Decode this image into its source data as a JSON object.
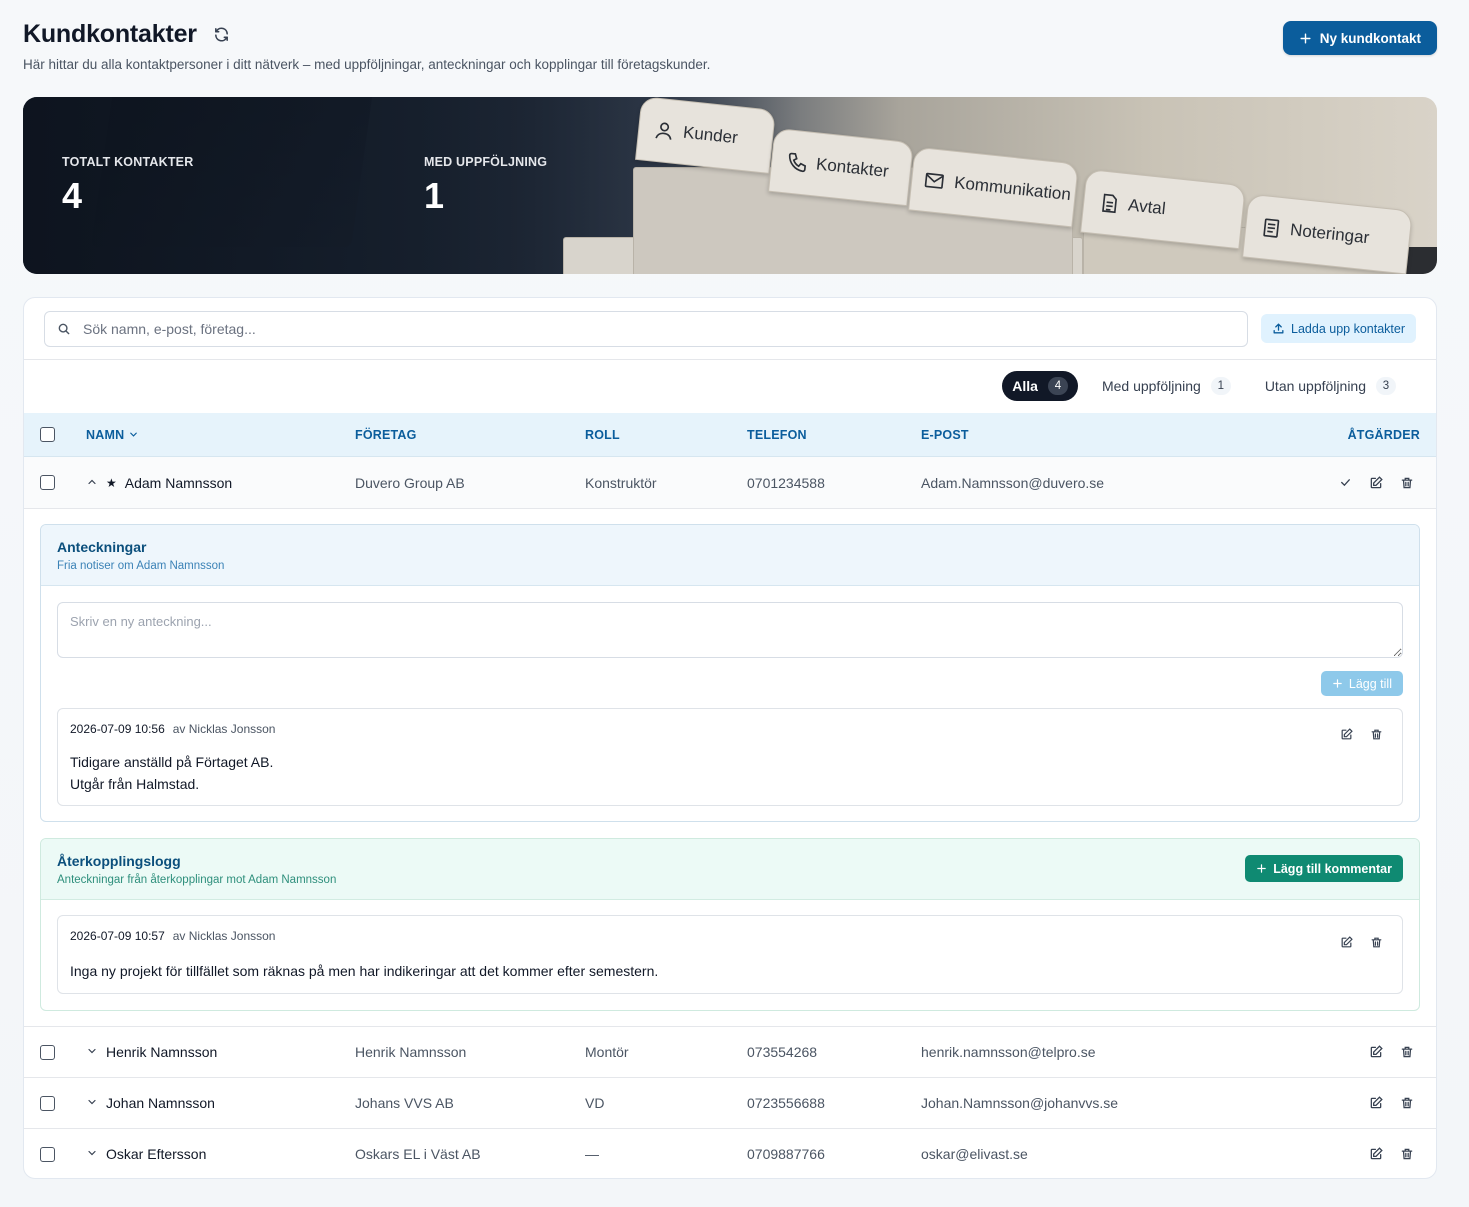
{
  "header": {
    "title": "Kundkontakter",
    "subtitle": "Här hittar du alla kontaktpersoner i ditt nätverk – med uppföljningar, anteckningar och kopplingar till företagskunder.",
    "new_button": "Ny kundkontakt"
  },
  "hero": {
    "stats": [
      {
        "label": "TOTALT KONTAKTER",
        "value": "4"
      },
      {
        "label": "MED UPPFÖLJNING",
        "value": "1"
      }
    ],
    "tabs": [
      "Kunder",
      "Kontakter",
      "Kommunikation",
      "Avtal",
      "Noteringar"
    ]
  },
  "search": {
    "placeholder": "Sök namn, e-post, företag..."
  },
  "upload_button": "Ladda upp kontakter",
  "filters": [
    {
      "label": "Alla",
      "count": "4"
    },
    {
      "label": "Med uppföljning",
      "count": "1"
    },
    {
      "label": "Utan uppföljning",
      "count": "3"
    }
  ],
  "table": {
    "columns": {
      "name": "NAMN",
      "company": "FÖRETAG",
      "role": "ROLL",
      "phone": "TELEFON",
      "email": "E-POST",
      "actions": "ÅTGÄRDER"
    },
    "rows": [
      {
        "name": "Adam Namnsson",
        "company": "Duvero Group AB",
        "role": "Konstruktör",
        "phone": "0701234588",
        "email": "Adam.Namnsson@duvero.se"
      },
      {
        "name": "Henrik Namnsson",
        "company": "Henrik Namnsson",
        "role": "Montör",
        "phone": "073554268",
        "email": "henrik.namnsson@telpro.se"
      },
      {
        "name": "Johan Namnsson",
        "company": "Johans VVS AB",
        "role": "VD",
        "phone": "0723556688",
        "email": "Johan.Namnsson@johanvvs.se"
      },
      {
        "name": "Oskar Eftersson",
        "company": "Oskars EL i Väst AB",
        "role": "—",
        "phone": "0709887766",
        "email": "oskar@elivast.se"
      }
    ]
  },
  "notes": {
    "title": "Anteckningar",
    "subtitle": "Fria notiser om Adam Namnsson",
    "placeholder": "Skriv en ny anteckning...",
    "add_button": "Lägg till",
    "entries": [
      {
        "timestamp": "2026-07-09 10:56",
        "author": "av Nicklas Jonsson",
        "line1": "Tidigare anställd på Förtaget AB.",
        "line2": "Utgår från Halmstad."
      }
    ]
  },
  "feedback": {
    "title": "Återkopplingslogg",
    "subtitle": "Anteckningar från återkopplingar mot Adam Namnsson",
    "add_button": "Lägg till kommentar",
    "entries": [
      {
        "timestamp": "2026-07-09 10:57",
        "author": "av Nicklas Jonsson",
        "text": "Inga ny projekt för tillfället som räknas på men har indikeringar att det kommer efter semestern."
      }
    ]
  },
  "colors": {
    "primary": "#0b5d9c",
    "accent_green": "#0f8a72",
    "table_header_bg": "#e6f3fb"
  }
}
